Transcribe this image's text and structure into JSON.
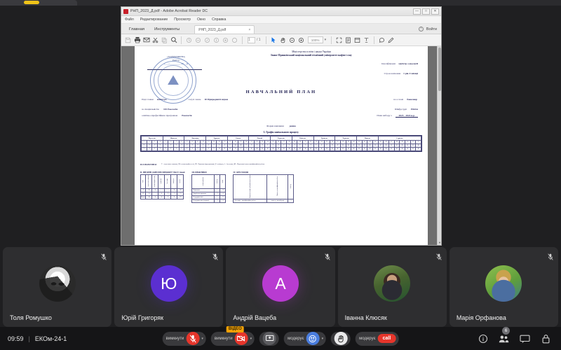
{
  "meeting": {
    "time": "09:59",
    "separator": "|",
    "room": "ЕКОм-24-1",
    "participant_count": "6",
    "controls": [
      {
        "id": "mic",
        "label": "вимкнути",
        "icon": "microphone-off-icon",
        "style": "red",
        "caret": true,
        "tooltip": ""
      },
      {
        "id": "camera",
        "label": "вимкнути",
        "icon": "camera-off-icon",
        "style": "red",
        "caret": true,
        "tooltip": "ВІДЕО"
      },
      {
        "id": "share",
        "label": "",
        "icon": "screen-share-icon",
        "style": "grey",
        "caret": false,
        "tooltip": ""
      },
      {
        "id": "react",
        "label": "модерує",
        "icon": "reactions-icon",
        "style": "blue",
        "caret": true,
        "tooltip": ""
      },
      {
        "id": "raise",
        "label": "",
        "icon": "raise-hand-icon",
        "style": "white",
        "caret": false,
        "tooltip": ""
      },
      {
        "id": "end",
        "label": "модерує",
        "icon": "end-call-icon",
        "style": "pill",
        "caret": false,
        "pill_text": "call"
      }
    ],
    "right_icons": [
      {
        "id": "info",
        "icon": "info-icon"
      },
      {
        "id": "participants",
        "icon": "participants-icon",
        "badge": "6"
      },
      {
        "id": "chat",
        "icon": "chat-icon"
      },
      {
        "id": "lock",
        "icon": "lock-icon"
      }
    ]
  },
  "participants": [
    {
      "name": "Толя Ромушко",
      "avatar_type": "photo",
      "photo_class": "ph-anime",
      "initial": "",
      "color": "#2a2a2a",
      "muted": true
    },
    {
      "name": "Юрій Григоряк",
      "avatar_type": "initial",
      "photo_class": "",
      "initial": "Ю",
      "color": "#5b2fd1",
      "muted": true
    },
    {
      "name": "Андрій Вацеба",
      "avatar_type": "initial",
      "photo_class": "",
      "initial": "А",
      "color": "#b83bd1",
      "muted": true
    },
    {
      "name": "Іванна Клюсяк",
      "avatar_type": "photo",
      "photo_class": "ph-girl",
      "initial": "",
      "color": "#47632f",
      "muted": true
    },
    {
      "name": "Марія Орфанова",
      "avatar_type": "photo",
      "photo_class": "ph-woman",
      "initial": "",
      "color": "#5f9e3c",
      "muted": true
    }
  ],
  "acrobat": {
    "window_title": "РНП_2023_Д.pdf - Adobe Acrobat Reader DC",
    "window_buttons": [
      "—",
      "□",
      "✕"
    ],
    "menu": [
      "Файл",
      "Редактирование",
      "Просмотр",
      "Окно",
      "Справка"
    ],
    "ribbon_tabs": [
      "Главная",
      "Инструменты"
    ],
    "doc_tab": "РНП_2023_Д.pdf",
    "doc_tab_close": "×",
    "signin_label": "Войти",
    "toolbar": {
      "page_current": "1",
      "page_total": "/ 1",
      "zoom_value": "100%",
      "zoom_caret": "▾",
      "icons": [
        "save-icon",
        "print-icon",
        "email-icon",
        "cut-icon",
        "copy-icon",
        "search-icon",
        "rotate-ccw-icon",
        "rotate-cw-icon",
        "select-text-icon",
        "stamp-icon",
        "fill-sign-icon",
        "comment-icon",
        "arrow-select-icon",
        "hand-tool-icon",
        "zoom-out-icon",
        "zoom-in-icon",
        "fit-width-icon",
        "page-fit-icon",
        "reading-mode-icon",
        "highlight-icon",
        "speech-bubble-icon",
        "pen-icon"
      ]
    }
  },
  "document": {
    "ministry_line1": "Міністерство освіти і науки України",
    "ministry_line2": "Івано-Франківський національний технічний університет нафти і газу",
    "approved_label": "«ЗАТВЕРДЖУЮ»",
    "approved_role": "Ректор",
    "approved_sign": "_____________",
    "approved_date": "«___»_________ 20__ р.",
    "stamp_text": "ІВАНО-ФРАНКІВСЬКИЙ НАЦІОНАЛЬНИЙ ТЕХНІЧНИЙ УНІВЕРСИТЕТ",
    "right_top": [
      {
        "label": "Кваліфікація:",
        "value": "магістр з екології"
      },
      {
        "label": "Строк навчання",
        "value": "1 рік 4 місяці"
      }
    ],
    "title": "НАВЧАЛЬНИЙ ПЛАН",
    "level_label": "Підготовки",
    "level_value": "магістра",
    "field_label": "галузі знань",
    "field_value": "10 Природничі науки",
    "base_label": "на основі",
    "base_value": "бакалавр",
    "specialty_label": "за спеціальністю",
    "specialty_value": "101 Екологія",
    "group_label": "Шифр груп",
    "group_value": "ЕКОм",
    "program_label": "освітньо-професійною програмою",
    "program_value": "Екологія",
    "plan_label": "План набору з",
    "plan_value": "2023 - 2024 н.р.",
    "form_label": "Форма навчання",
    "form_value": "денна",
    "section1": "І. Графік навчального процесу",
    "months": [
      "Вересень",
      "Жовтень",
      "Листопад",
      "Грудень",
      "Січень",
      "Лютий",
      "Березень",
      "Квітень",
      "Травень",
      "Червень",
      "Липень",
      "Серпень"
    ],
    "calendar_rows": [
      {
        "course": "І",
        "cells": [
          "Т",
          "Т",
          "Т",
          "Т",
          "Т",
          "Т",
          "Т",
          "Т",
          "Т",
          "Т",
          "Т",
          "Т",
          "Т",
          "Т",
          "Т",
          "Е",
          "Е",
          "К",
          "К",
          "Т",
          "Т",
          "Т",
          "Т",
          "Т",
          "Т",
          "Т",
          "Т",
          "Т",
          "Т",
          "Т",
          "Т",
          "Т",
          "Т",
          "Е",
          "Е",
          "П",
          "П",
          "К",
          "К",
          "К",
          "К",
          "К",
          "К",
          "К",
          "К",
          "К",
          "К",
          "К",
          "К",
          "К",
          "К",
          "К"
        ]
      },
      {
        "course": "ІІ",
        "cells": [
          "Т",
          "Т",
          "Т",
          "Т",
          "Т",
          "Т",
          "Т",
          "Т",
          "Т",
          "Т",
          "Т",
          "Т",
          "Т",
          "Т",
          "П",
          "П",
          "П",
          "П",
          "А",
          "А",
          "К",
          "К",
          "К",
          "К",
          "К",
          "К",
          "К",
          "К",
          "К",
          "К",
          "К",
          "К",
          "К",
          "К",
          "К",
          "К",
          "К",
          "К",
          "К",
          "К",
          "К",
          "К",
          "К",
          "К",
          "К",
          "К",
          "К",
          "К",
          "К",
          "К",
          "К",
          "К"
        ]
      }
    ],
    "legend_label": "ПОЗНАЧЕННЯ:",
    "legend_text": "Т – теоретичне навчання, ЕК- екзаменаційна сесія, ПР - Практика (вид практики), К - канікули, А - Атестація, ДП - Підготовка/захист кваліфікаційної роботи",
    "table2": {
      "title": "ІІ. ЗВЕДЕНІ ДАНІ ПРО БЮДЖЕТ ЧАСУ, тижні",
      "headers": [
        "Курс",
        "Теоретичне навчання",
        "Екзаменаційна сесія",
        "Практика",
        "Атестація",
        "Канікули",
        "Всього"
      ],
      "rows": [
        [
          "І",
          "30",
          "4",
          "",
          "",
          "8",
          "42"
        ],
        [
          "ІІ",
          "14",
          "",
          "4",
          "2",
          "1",
          "21"
        ],
        [
          "Всього",
          "44",
          "4",
          "4",
          "2",
          "9",
          "63"
        ]
      ]
    },
    "table3": {
      "title": "ІІІ. ПРАКТИКИ",
      "headers": [
        "Назва практики",
        "Семестр",
        "Тижні"
      ],
      "rows": [
        [
          "Навчальна",
          "",
          "4"
        ],
        [
          "Виробнича практика",
          "3",
          "4"
        ],
        [
          "Переддипломна",
          "",
          "2"
        ],
        [
          "Переддипломна (наукова)",
          "3",
          "4"
        ]
      ]
    },
    "table4": {
      "title": "IV. АТЕСТАЦІЯ",
      "headers": [
        "Форма атестації здобувачів вищої освіти",
        "Вимоги до кваліфікаційної роботи",
        "Семестр"
      ],
      "rows": [
        [
          "Атестація - кваліфікаційна робота",
          "захист у вченій раді",
          "3"
        ]
      ]
    }
  }
}
